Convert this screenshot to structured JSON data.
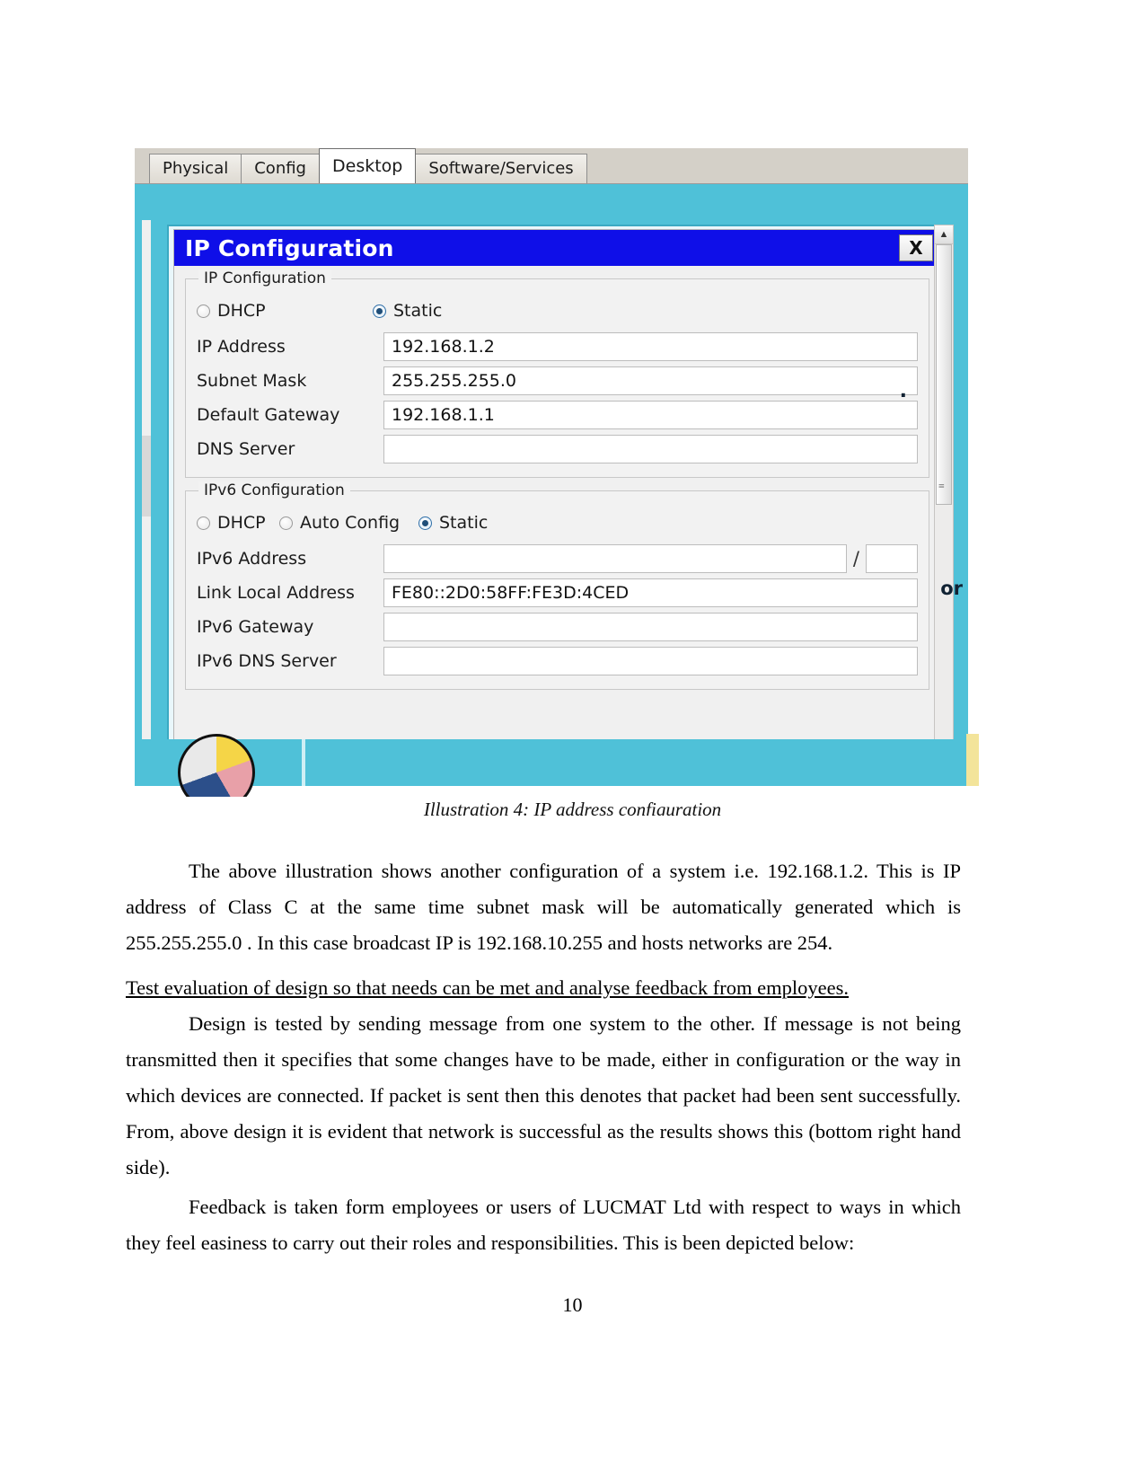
{
  "figure": {
    "tabs": [
      {
        "label": "Physical",
        "active": false
      },
      {
        "label": "Config",
        "active": false
      },
      {
        "label": "Desktop",
        "active": true
      },
      {
        "label": "Software/Services",
        "active": false
      }
    ],
    "window": {
      "title": "IP Configuration",
      "close_label": "X"
    },
    "ipv4": {
      "legend": "IP Configuration",
      "mode_options": [
        "DHCP",
        "Static"
      ],
      "mode_selected": "Static",
      "fields": [
        {
          "label": "IP Address",
          "value": "192.168.1.2"
        },
        {
          "label": "Subnet Mask",
          "value": "255.255.255.0"
        },
        {
          "label": "Default Gateway",
          "value": "192.168.1.1"
        },
        {
          "label": "DNS Server",
          "value": ""
        }
      ]
    },
    "ipv6": {
      "legend": "IPv6 Configuration",
      "mode_options": [
        "DHCP",
        "Auto Config",
        "Static"
      ],
      "mode_selected": "Static",
      "address_label": "IPv6 Address",
      "address_value": "",
      "prefix_separator": "/",
      "prefix_value": "",
      "fields": [
        {
          "label": "Link Local Address",
          "value": "FE80::2D0:58FF:FE3D:4CED"
        },
        {
          "label": "IPv6 Gateway",
          "value": ""
        },
        {
          "label": "IPv6 DNS Server",
          "value": ""
        }
      ]
    },
    "scrollbar": {
      "up_arrow": "▲",
      "down_arrow": "▼",
      "grip": "≡"
    },
    "edge_artifacts": {
      "partial_label": "or",
      "dot": "."
    },
    "caption": "Illustration 4: IP address configuration"
  },
  "document": {
    "paragraph1": "The above illustration shows another configuration of a system i.e. 192.168.1.2. This is IP address of Class C at the same time subnet mask will be automatically generated which is 255.255.255.0 . In this case broadcast IP is 192.168.10.255 and hosts networks are 254.",
    "heading1": "Test evaluation of design so that needs can be met and analyse feedback from employees.",
    "paragraph2": "Design is tested by sending message from one system to the other. If message is not being transmitted then it specifies that some changes have to be made, either in configuration or the way in which devices are connected. If packet is sent then this denotes that packet had been sent successfully. From, above design it is evident that network is successful as the results shows this (bottom right hand side).",
    "paragraph3": "Feedback is taken form employees or users of LUCMAT Ltd with respect to ways in which they feel easiness to carry out their roles and responsibilities. This is been depicted below:",
    "page_number": "10"
  },
  "colors": {
    "titlebar": "#0f0fe8",
    "pane_teal": "#4fc1d8",
    "tab_active": "#ffffff"
  }
}
